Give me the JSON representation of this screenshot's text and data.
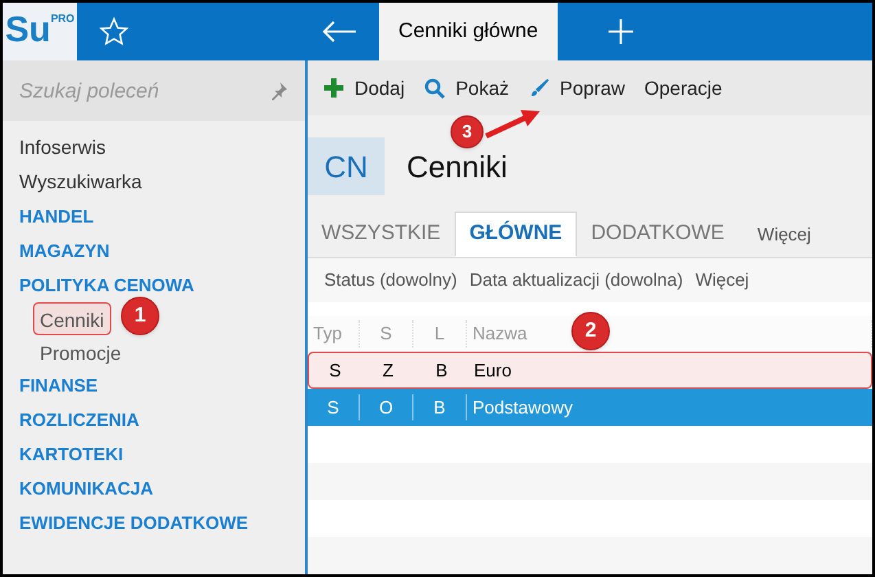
{
  "app": {
    "logo": "Su",
    "logo_sup": "PRO"
  },
  "top_tabs": [
    {
      "label": "Cenniki główne",
      "selected": true
    }
  ],
  "sidebar": {
    "search": {
      "placeholder": "Szukaj poleceń"
    },
    "items": [
      {
        "label": "Infoserwis",
        "kind": "link"
      },
      {
        "label": "Wyszukiwarka",
        "kind": "link"
      },
      {
        "label": "HANDEL",
        "kind": "section"
      },
      {
        "label": "MAGAZYN",
        "kind": "section"
      },
      {
        "label": "POLITYKA CENOWA",
        "kind": "section",
        "children": [
          {
            "label": "Cenniki",
            "highlighted": true
          },
          {
            "label": "Promocje",
            "highlighted": false
          }
        ]
      },
      {
        "label": "FINANSE",
        "kind": "section"
      },
      {
        "label": "ROZLICZENIA",
        "kind": "section"
      },
      {
        "label": "KARTOTEKI",
        "kind": "section"
      },
      {
        "label": "KOMUNIKACJA",
        "kind": "section"
      },
      {
        "label": "EWIDENCJE DODATKOWE",
        "kind": "section"
      }
    ]
  },
  "toolbar": [
    {
      "label": "Dodaj",
      "kind": "add"
    },
    {
      "label": "Pokaż",
      "kind": "show"
    },
    {
      "label": "Popraw",
      "kind": "edit"
    },
    {
      "label": "Operacje",
      "kind": "menu"
    }
  ],
  "header": {
    "badge": "CN",
    "title": "Cenniki"
  },
  "view_tabs": [
    {
      "label": "WSZYSTKIE",
      "selected": false
    },
    {
      "label": "GŁÓWNE",
      "selected": true
    },
    {
      "label": "DODATKOWE",
      "selected": false
    }
  ],
  "view_tabs_more": "Więcej",
  "filters": [
    "Status (dowolny)",
    "Data aktualizacji (dowolna)",
    "Więcej"
  ],
  "table": {
    "columns": [
      "Typ",
      "S",
      "L",
      "Nazwa"
    ],
    "rows": [
      {
        "cells": [
          "S",
          "Z",
          "B",
          "Euro"
        ],
        "selected": false,
        "highlighted": true
      },
      {
        "cells": [
          "S",
          "O",
          "B",
          "Podstawowy"
        ],
        "selected": true,
        "highlighted": false
      }
    ]
  },
  "annotations": [
    {
      "number": "1"
    },
    {
      "number": "2"
    },
    {
      "number": "3"
    }
  ]
}
